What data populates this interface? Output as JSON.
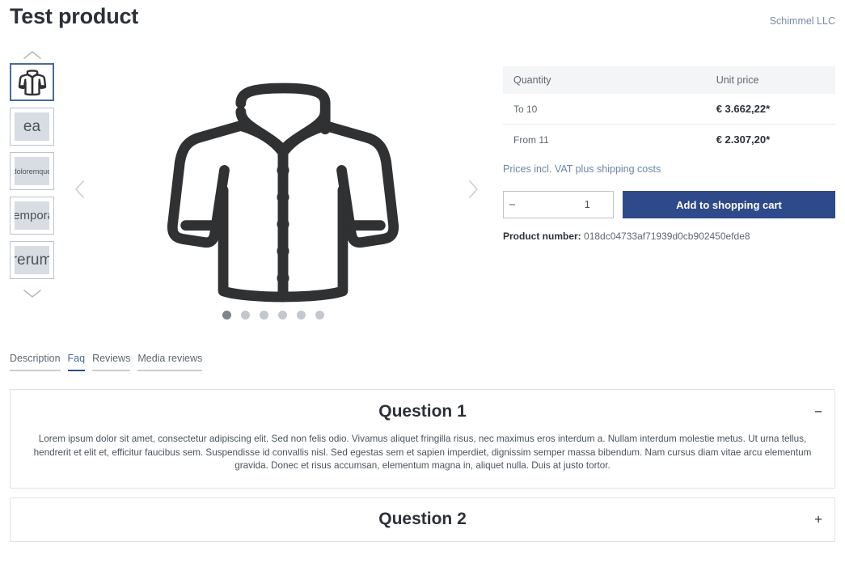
{
  "header": {
    "title": "Test product",
    "manufacturer": "Schimmel LLC"
  },
  "gallery": {
    "up_arrow_icon": "chevron-up-icon",
    "down_arrow_icon": "chevron-down-icon",
    "prev_arrow_icon": "chevron-left-icon",
    "next_arrow_icon": "chevron-right-icon",
    "main_image_alt": "jacket-placeholder-icon",
    "thumbnails": [
      {
        "label": "",
        "type": "jacket-icon",
        "active": true
      },
      {
        "label": "ea",
        "type": "text",
        "active": false
      },
      {
        "label": "doloremque",
        "type": "text",
        "active": false
      },
      {
        "label": "tempora",
        "type": "text",
        "active": false
      },
      {
        "label": "rerum",
        "type": "text",
        "active": false
      }
    ],
    "dots": {
      "count": 6,
      "active_index": 0
    }
  },
  "buybox": {
    "table": {
      "headers": [
        "Quantity",
        "Unit price"
      ],
      "rows": [
        {
          "quantity": "To 10",
          "price": "€ 3.662,22*"
        },
        {
          "quantity": "From 11",
          "price": "€ 2.307,20*"
        }
      ]
    },
    "vat_link": "Prices incl. VAT plus shipping costs",
    "quantity": {
      "decrease_label": "−",
      "value": "1",
      "increase_label": "+"
    },
    "add_to_cart_label": "Add to shopping cart",
    "product_number_label": "Product number:",
    "product_number_value": "018dc04733af71939d0cb902450efde8"
  },
  "tabs": [
    {
      "label": "Description",
      "active": false
    },
    {
      "label": "Faq",
      "active": true
    },
    {
      "label": "Reviews",
      "active": false
    },
    {
      "label": "Media reviews",
      "active": false
    }
  ],
  "accordion": [
    {
      "title": "Question 1",
      "toggle": "−",
      "expanded": true,
      "body": "Lorem ipsum dolor sit amet, consectetur adipiscing elit. Sed non felis odio. Vivamus aliquet fringilla risus, nec maximus eros interdum a. Nullam interdum molestie metus. Ut urna tellus, hendrerit et elit et, efficitur faucibus sem. Suspendisse id convallis nisl. Sed egestas sem et sapien imperdiet, dignissim semper massa bibendum. Nam cursus diam vitae arcu elementum gravida. Donec et risus accumsan, elementum magna in, aliquet nulla. Duis at justo tortor."
    },
    {
      "title": "Question 2",
      "toggle": "+",
      "expanded": false,
      "body": ""
    }
  ],
  "colors": {
    "accent": "#2e4a8a",
    "link": "#6b86a8",
    "text": "#4a545b",
    "heading": "#2b3136",
    "table_header_bg": "#f4f5f6",
    "thumb_placeholder": "#d8dde3",
    "border": "#dfe3e6"
  }
}
